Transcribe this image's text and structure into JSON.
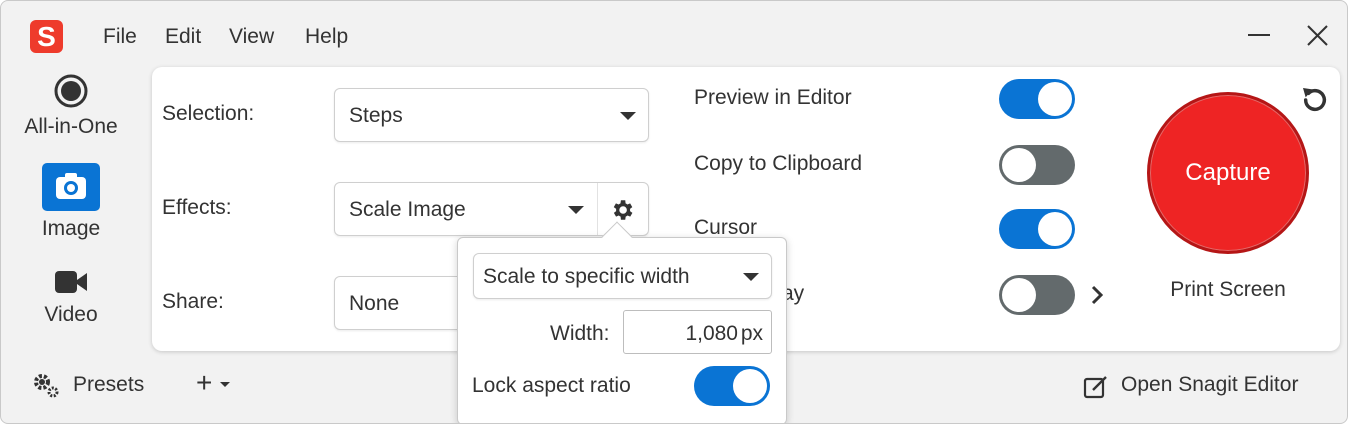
{
  "app": {
    "logo_letter": "S"
  },
  "menu": [
    "File",
    "Edit",
    "View",
    "Help"
  ],
  "modes": [
    {
      "label": "All-in-One",
      "icon": "record-icon",
      "selected": false
    },
    {
      "label": "Image",
      "icon": "camera-icon",
      "selected": true
    },
    {
      "label": "Video",
      "icon": "video-camera-icon",
      "selected": false
    }
  ],
  "settings": {
    "selection_label": "Selection:",
    "selection_value": "Steps",
    "effects_label": "Effects:",
    "effects_value": "Scale Image",
    "share_label": "Share:",
    "share_value": "None"
  },
  "options": [
    {
      "label": "Preview in Editor",
      "on": true
    },
    {
      "label": "Copy to Clipboard",
      "on": false
    },
    {
      "label": "Cursor",
      "on": true
    },
    {
      "label": "ay",
      "on": false
    }
  ],
  "capture": {
    "label": "Capture",
    "hotkey": "Print Screen"
  },
  "bottom": {
    "presets_label": "Presets",
    "add_label": "+",
    "editor_label": "Open Snagit Editor"
  },
  "popover": {
    "scale_mode": "Scale to specific width",
    "width_label": "Width:",
    "width_value": "1,080",
    "width_unit": "px",
    "lock_label": "Lock aspect ratio",
    "lock_on": true
  },
  "colors": {
    "accent": "#0a74d4",
    "capture": "#ee2424",
    "toggle_off": "#636a6c",
    "logo": "#ee3b2c"
  }
}
